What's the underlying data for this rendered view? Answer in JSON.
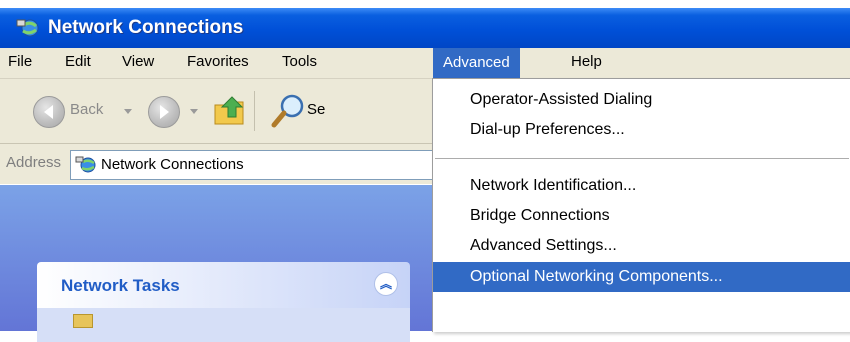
{
  "window": {
    "title": "Network Connections",
    "title_icon": "network-connections-icon"
  },
  "menubar": {
    "items": [
      {
        "label": "File"
      },
      {
        "label": "Edit"
      },
      {
        "label": "View"
      },
      {
        "label": "Favorites"
      },
      {
        "label": "Tools"
      },
      {
        "label": "Advanced"
      },
      {
        "label": "Help"
      }
    ]
  },
  "toolbar": {
    "back_label": "Back",
    "search_label_partial": "Se",
    "icons": [
      "back-arrow-icon",
      "forward-arrow-icon",
      "folder-up-icon",
      "search-icon"
    ]
  },
  "address": {
    "label": "Address",
    "value": "Network Connections"
  },
  "left_pane": {
    "panel_title": "Network Tasks",
    "collapse_glyph": "︽"
  },
  "advanced_menu": {
    "items": [
      {
        "label": "Operator-Assisted Dialing"
      },
      {
        "label": "Dial-up Preferences..."
      },
      {
        "label": "Network Identification..."
      },
      {
        "label": "Bridge Connections"
      },
      {
        "label": "Advanced Settings..."
      },
      {
        "label": "Optional Networking Components..."
      }
    ],
    "selected_index": 5
  },
  "colors": {
    "titlebar": "#0050d8",
    "menu_highlight": "#316ac5",
    "chrome": "#ece9d8",
    "task_pane": "#7ba2e7"
  }
}
